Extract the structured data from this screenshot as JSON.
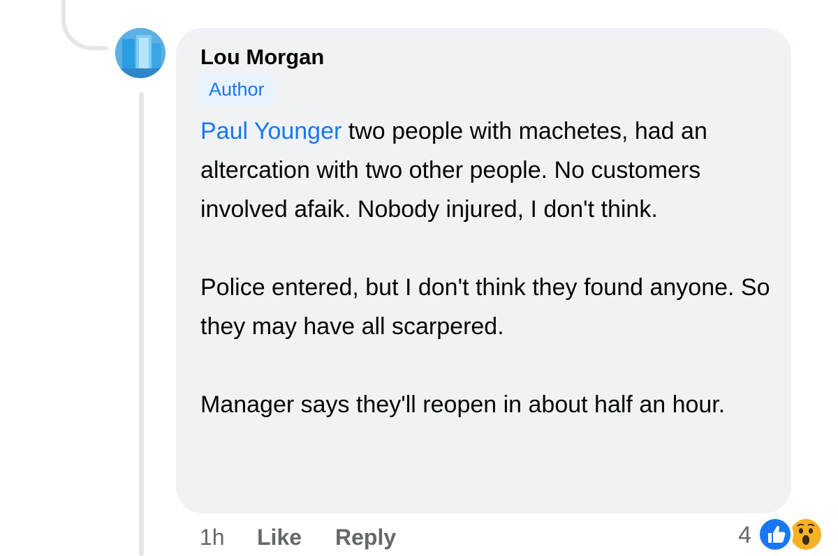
{
  "comment": {
    "author": "Lou Morgan",
    "badge": "Author",
    "mention": "Paul Younger",
    "paragraph_1_rest": " two people with machetes, had an altercation with two other people. No customers involved afaik. Nobody injured, I don't think.",
    "paragraph_2": "Police entered, but I don't think they found anyone. So they may have all scarpered.",
    "paragraph_3": "Manager says they'll reopen in about half an hour."
  },
  "actions": {
    "time": "1h",
    "like": "Like",
    "reply": "Reply"
  },
  "reactions": {
    "count": "4",
    "icons": [
      "like-reaction-icon",
      "wow-reaction-icon"
    ]
  },
  "colors": {
    "bubble_bg": "#f0f2f5",
    "link_blue": "#1877f2",
    "muted_text": "#65676b",
    "badge_bg": "#e7f3ff",
    "wow_yellow": "#f7b125"
  }
}
